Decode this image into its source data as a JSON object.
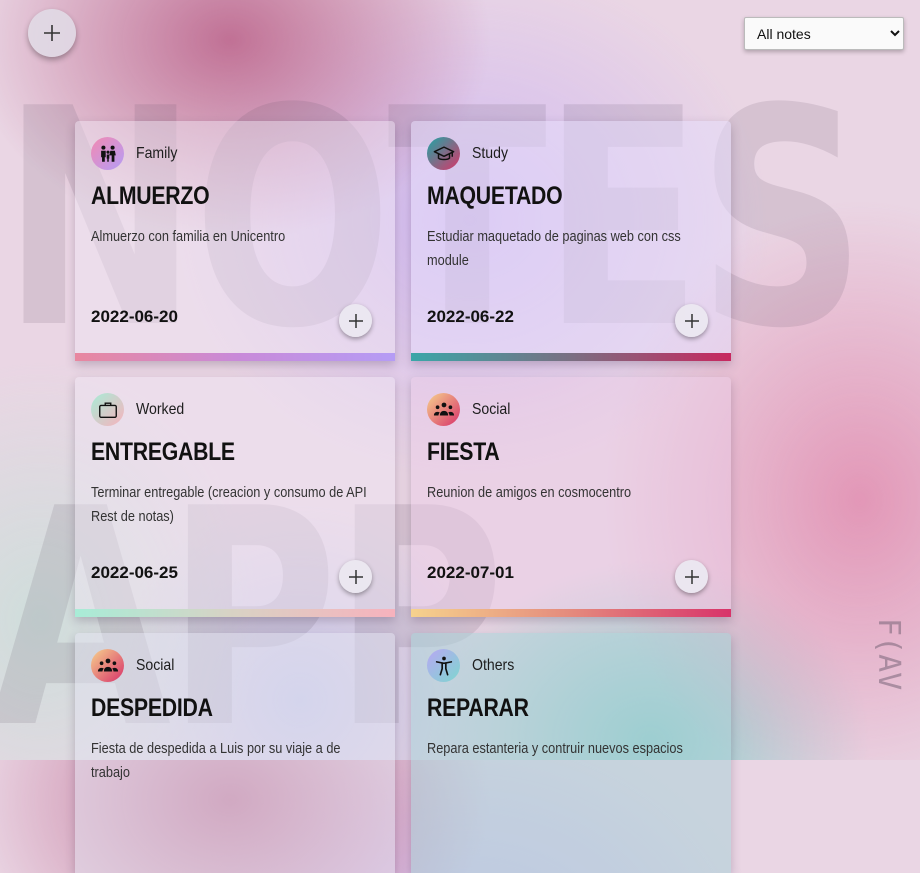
{
  "background": {
    "word_top": "NOTES",
    "word_bottom": "APP",
    "signature": "F(AV"
  },
  "toolbar": {
    "add_icon": "plus-icon"
  },
  "filter": {
    "selected": "All notes",
    "options": [
      "All notes"
    ]
  },
  "colors": {
    "family": [
      "#e887b5",
      "#b59cf5"
    ],
    "study": [
      "#3aa6a8",
      "#c8285f"
    ],
    "worked": [
      "#a8ecd7",
      "#f7b2bd"
    ],
    "social": [
      "#f6d28d",
      "#d8336a"
    ],
    "others": [
      "#b8a7f3",
      "#7ed6cf"
    ]
  },
  "notes": [
    {
      "category": "Family",
      "icon": "family-icon",
      "title": "ALMUERZO",
      "description": "Almuerzo con familia en Unicentro",
      "date": "2022-06-20"
    },
    {
      "category": "Study",
      "icon": "graduation-cap-icon",
      "title": "MAQUETADO",
      "description": "Estudiar maquetado de paginas web con css module",
      "date": "2022-06-22"
    },
    {
      "category": "Worked",
      "icon": "briefcase-icon",
      "title": "ENTREGABLE",
      "description": "Terminar entregable (creacion y consumo de API Rest de notas)",
      "date": "2022-06-25"
    },
    {
      "category": "Social",
      "icon": "group-icon",
      "title": "FIESTA",
      "description": "Reunion de amigos en cosmocentro",
      "date": "2022-07-01"
    },
    {
      "category": "Social",
      "icon": "group-icon",
      "title": "DESPEDIDA",
      "description": "Fiesta de despedida a Luis por su viaje a de trabajo",
      "date": ""
    },
    {
      "category": "Others",
      "icon": "accessibility-icon",
      "title": "REPARAR",
      "description": "Repara estanteria y contruir nuevos espacios",
      "date": ""
    }
  ]
}
